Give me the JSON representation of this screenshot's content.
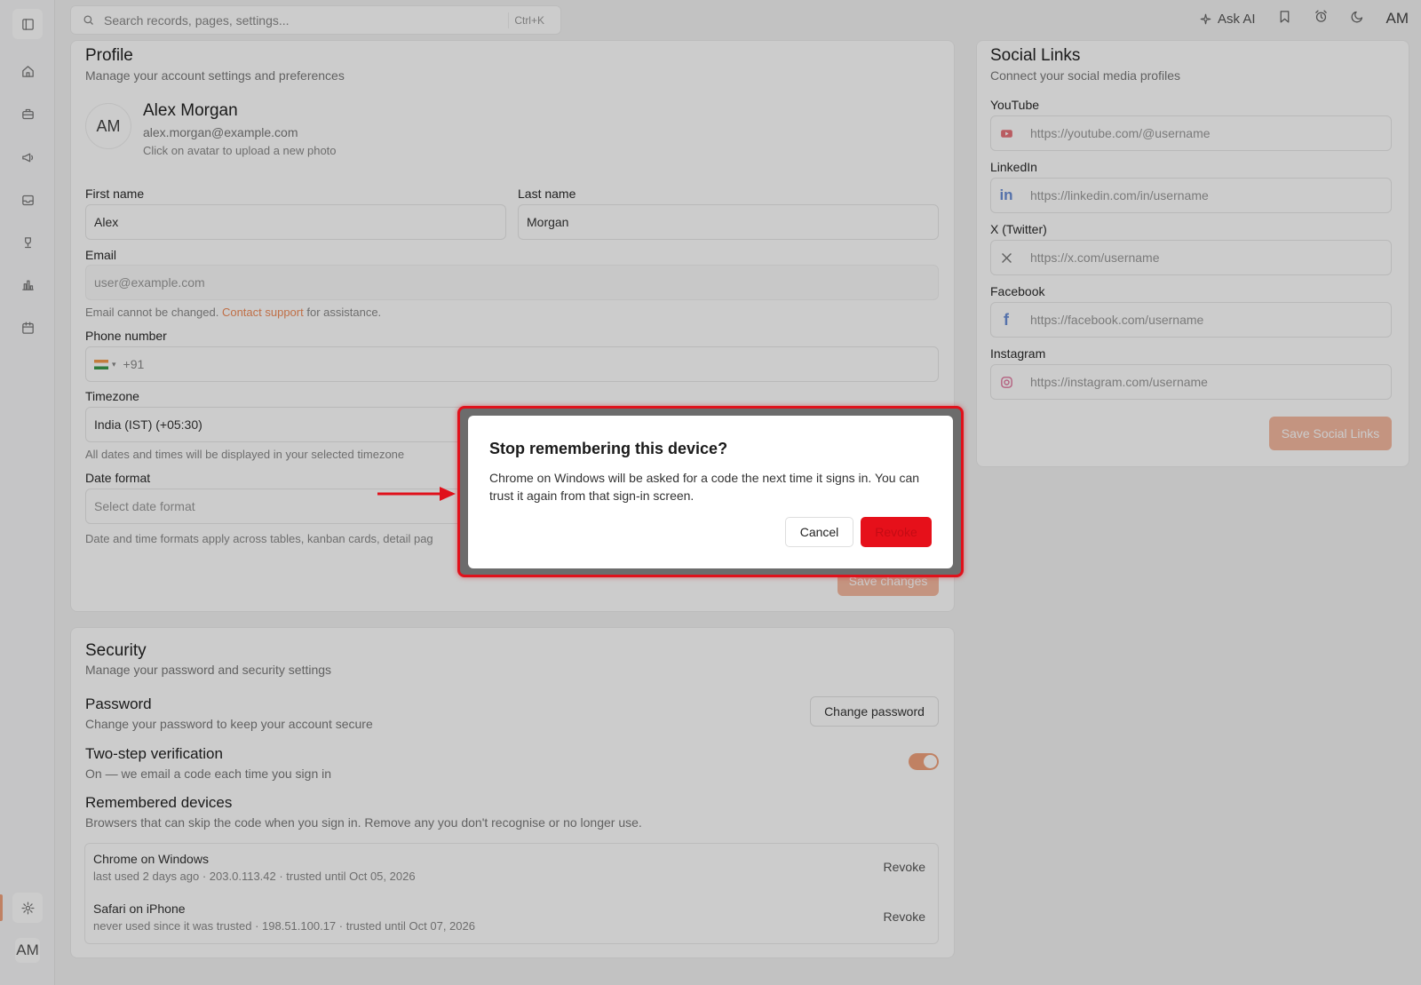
{
  "topbar": {
    "search_placeholder": "Search records, pages, settings...",
    "search_shortcut": "Ctrl+K",
    "ask_ai_label": "Ask AI",
    "avatar_initials": "AM"
  },
  "sidebar": {
    "avatar_initials": "AM",
    "icons": [
      "panel-toggle-icon",
      "home-icon",
      "briefcase-icon",
      "megaphone-icon",
      "inbox-icon",
      "trophy-icon",
      "bar-chart-icon",
      "calendar-icon",
      "gear-icon"
    ]
  },
  "profile": {
    "title": "Profile",
    "subtitle": "Manage your account settings and preferences",
    "avatar_initials": "AM",
    "name": "Alex Morgan",
    "email": "alex.morgan@example.com",
    "avatar_hint": "Click on avatar to upload a new photo",
    "first_name_label": "First name",
    "first_name_value": "Alex",
    "last_name_label": "Last name",
    "last_name_value": "Morgan",
    "email_label": "Email",
    "email_placeholder": "user@example.com",
    "email_help_prefix": "Email cannot be changed.",
    "email_help_link": "Contact support",
    "email_help_suffix": "for assistance.",
    "phone_label": "Phone number",
    "phone_code": "+91",
    "timezone_label": "Timezone",
    "timezone_value": "India (IST) (+05:30)",
    "timezone_help": "All dates and times will be displayed in your selected timezone",
    "date_format_label": "Date format",
    "date_format_placeholder": "Select date format",
    "date_format_help": "Date and time formats apply across tables, kanban cards, detail pag",
    "save_label": "Save changes"
  },
  "security": {
    "title": "Security",
    "subtitle": "Manage your password and security settings",
    "password_title": "Password",
    "password_sub": "Change your password to keep your account secure",
    "change_password_label": "Change password",
    "two_step_title": "Two-step verification",
    "two_step_sub": "On — we email a code each time you sign in",
    "two_step_enabled": true,
    "devices_title": "Remembered devices",
    "devices_sub": "Browsers that can skip the code when you sign in. Remove any you don't recognise or no longer use.",
    "devices": [
      {
        "name": "Chrome on Windows",
        "meta": "last used 2 days ago · 203.0.113.42 · trusted until Oct 05, 2026",
        "action": "Revoke"
      },
      {
        "name": "Safari on iPhone",
        "meta": "never used since it was trusted · 198.51.100.17 · trusted until Oct 07, 2026",
        "action": "Revoke"
      }
    ]
  },
  "social": {
    "title": "Social Links",
    "subtitle": "Connect your social media profiles",
    "links": [
      {
        "label": "YouTube",
        "placeholder": "https://youtube.com/@username",
        "icon": "youtube-icon"
      },
      {
        "label": "LinkedIn",
        "placeholder": "https://linkedin.com/in/username",
        "icon": "linkedin-icon"
      },
      {
        "label": "X (Twitter)",
        "placeholder": "https://x.com/username",
        "icon": "x-icon"
      },
      {
        "label": "Facebook",
        "placeholder": "https://facebook.com/username",
        "icon": "facebook-icon"
      },
      {
        "label": "Instagram",
        "placeholder": "https://instagram.com/username",
        "icon": "instagram-icon"
      }
    ],
    "save_label": "Save Social Links"
  },
  "dialog": {
    "title": "Stop remembering this device?",
    "body_device": "Chrome on Windows",
    "body_text": "will be asked for a code the next time it signs in. You can trust it again from that sign-in screen.",
    "cancel_label": "Cancel",
    "confirm_label": "Revoke"
  },
  "colors": {
    "accent": "#f0a27c",
    "danger": "#e6101a",
    "highlight": "#e0111b"
  }
}
